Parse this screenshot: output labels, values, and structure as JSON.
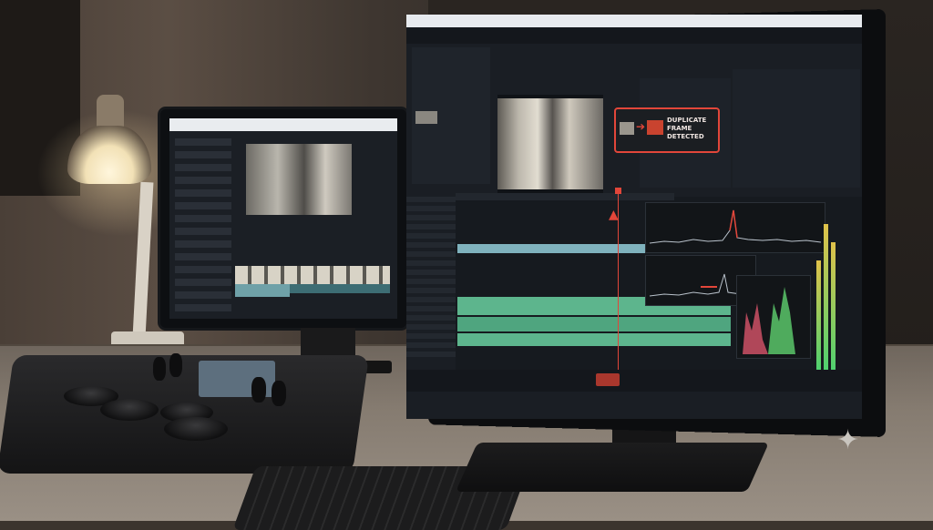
{
  "alert": {
    "text": "DUPLICATE FRAME DETECTED",
    "warning_icon": "warning-triangle-icon",
    "arrow_icon": "arrow-right-icon"
  },
  "editor": {
    "accent_color": "#e2463a",
    "clip_color": "#7fb2bd",
    "audio_color": "#5db58d"
  },
  "icons": {
    "logo": "sparkle-icon"
  }
}
